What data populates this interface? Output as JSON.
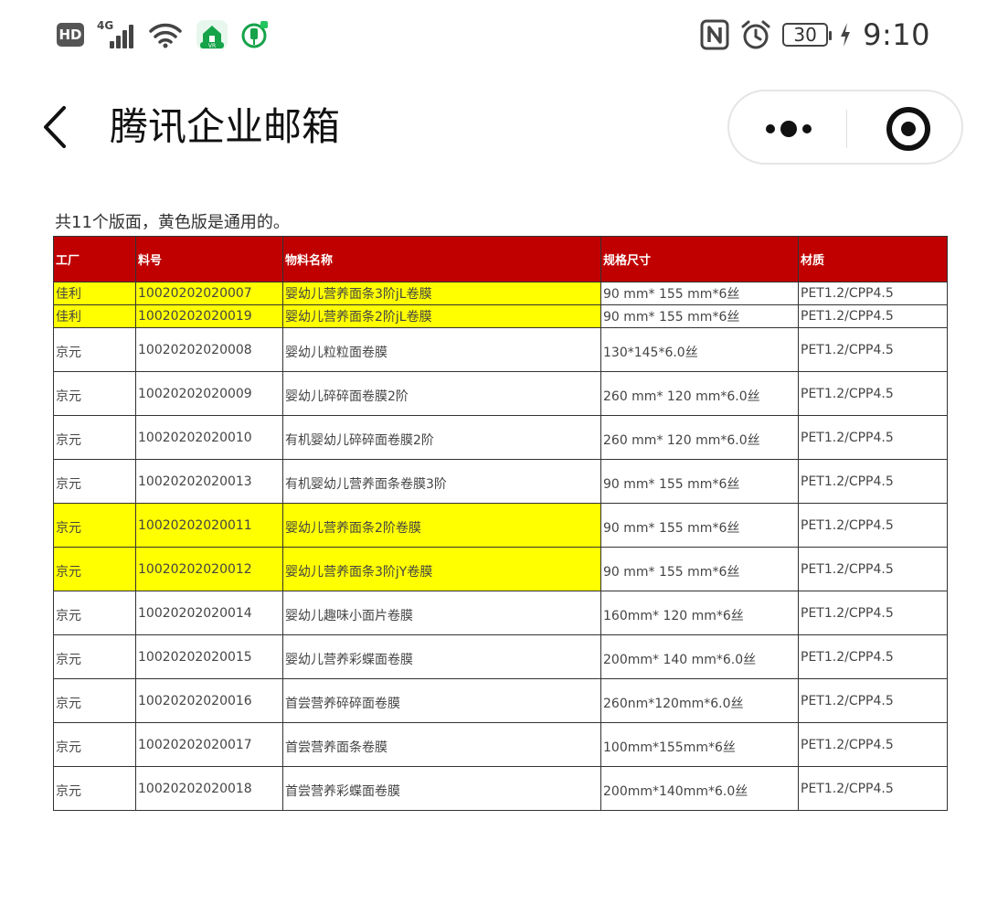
{
  "status_bar": {
    "hd": "HD",
    "network": "4G",
    "app_badge": "VR",
    "battery": "30",
    "time": "9:10",
    "icons": [
      "hd-icon",
      "signal-icon",
      "wifi-icon",
      "home-app-icon",
      "plug-app-icon",
      "nfc-icon",
      "alarm-icon",
      "battery-icon",
      "charging-icon"
    ]
  },
  "nav": {
    "title": "腾讯企业邮箱",
    "back_icon": "chevron-left-icon",
    "more_icon": "more-dots-icon",
    "close_icon": "target-close-icon"
  },
  "note": "共11个版面，黄色版是通用的。",
  "table": {
    "header_color": "#c00000",
    "highlight_color": "#ffff00",
    "columns": [
      "工厂",
      "料号",
      "物料名称",
      "规格尺寸",
      "材质"
    ],
    "rows": [
      {
        "cells": [
          "佳利",
          "10020202020007",
          "婴幼儿营养面条3阶jL卷膜",
          "90 mm* 155 mm*6丝",
          "PET1.2/CPP4.5"
        ],
        "highlight": [
          0,
          1,
          2
        ],
        "size": "short"
      },
      {
        "cells": [
          "佳利",
          "10020202020019",
          "婴幼儿营养面条2阶jL卷膜",
          "90 mm* 155 mm*6丝",
          "PET1.2/CPP4.5"
        ],
        "highlight": [
          0,
          1,
          2
        ],
        "size": "short"
      },
      {
        "cells": [
          "京元",
          "10020202020008",
          "婴幼儿粒粒面卷膜",
          "130*145*6.0丝",
          "PET1.2/CPP4.5"
        ],
        "highlight": [],
        "size": "tall"
      },
      {
        "cells": [
          "京元",
          "10020202020009",
          "婴幼儿碎碎面卷膜2阶",
          "260 mm* 120 mm*6.0丝",
          "PET1.2/CPP4.5"
        ],
        "highlight": [],
        "size": "tall"
      },
      {
        "cells": [
          "京元",
          "10020202020010",
          "有机婴幼儿碎碎面卷膜2阶",
          "260 mm* 120 mm*6.0丝",
          "PET1.2/CPP4.5"
        ],
        "highlight": [],
        "size": "tall"
      },
      {
        "cells": [
          "京元",
          "10020202020013",
          "有机婴幼儿营养面条卷膜3阶",
          "90 mm* 155 mm*6丝",
          "PET1.2/CPP4.5"
        ],
        "highlight": [],
        "size": "tall"
      },
      {
        "cells": [
          "京元",
          "10020202020011",
          "婴幼儿营养面条2阶卷膜",
          "90 mm* 155 mm*6丝",
          "PET1.2/CPP4.5"
        ],
        "highlight": [
          0,
          1,
          2
        ],
        "size": "tall"
      },
      {
        "cells": [
          "京元",
          "10020202020012",
          "婴幼儿营养面条3阶jY卷膜",
          "90 mm* 155 mm*6丝",
          "PET1.2/CPP4.5"
        ],
        "highlight": [
          0,
          1,
          2
        ],
        "size": "tall"
      },
      {
        "cells": [
          "京元",
          "10020202020014",
          "婴幼儿趣味小面片卷膜",
          "160mm* 120 mm*6丝",
          "PET1.2/CPP4.5"
        ],
        "highlight": [],
        "size": "tall"
      },
      {
        "cells": [
          "京元",
          "10020202020015",
          "婴幼儿营养彩蝶面卷膜",
          "200mm* 140 mm*6.0丝",
          "PET1.2/CPP4.5"
        ],
        "highlight": [],
        "size": "tall"
      },
      {
        "cells": [
          "京元",
          "10020202020016",
          "首尝营养碎碎面卷膜",
          "260nm*120mm*6.0丝",
          "PET1.2/CPP4.5"
        ],
        "highlight": [],
        "size": "tall"
      },
      {
        "cells": [
          "京元",
          "10020202020017",
          "首尝营养面条卷膜",
          "100mm*155mm*6丝",
          "PET1.2/CPP4.5"
        ],
        "highlight": [],
        "size": "tall"
      },
      {
        "cells": [
          "京元",
          "10020202020018",
          "首尝营养彩蝶面卷膜",
          "200mm*140mm*6.0丝",
          "PET1.2/CPP4.5"
        ],
        "highlight": [],
        "size": "tall"
      }
    ]
  }
}
